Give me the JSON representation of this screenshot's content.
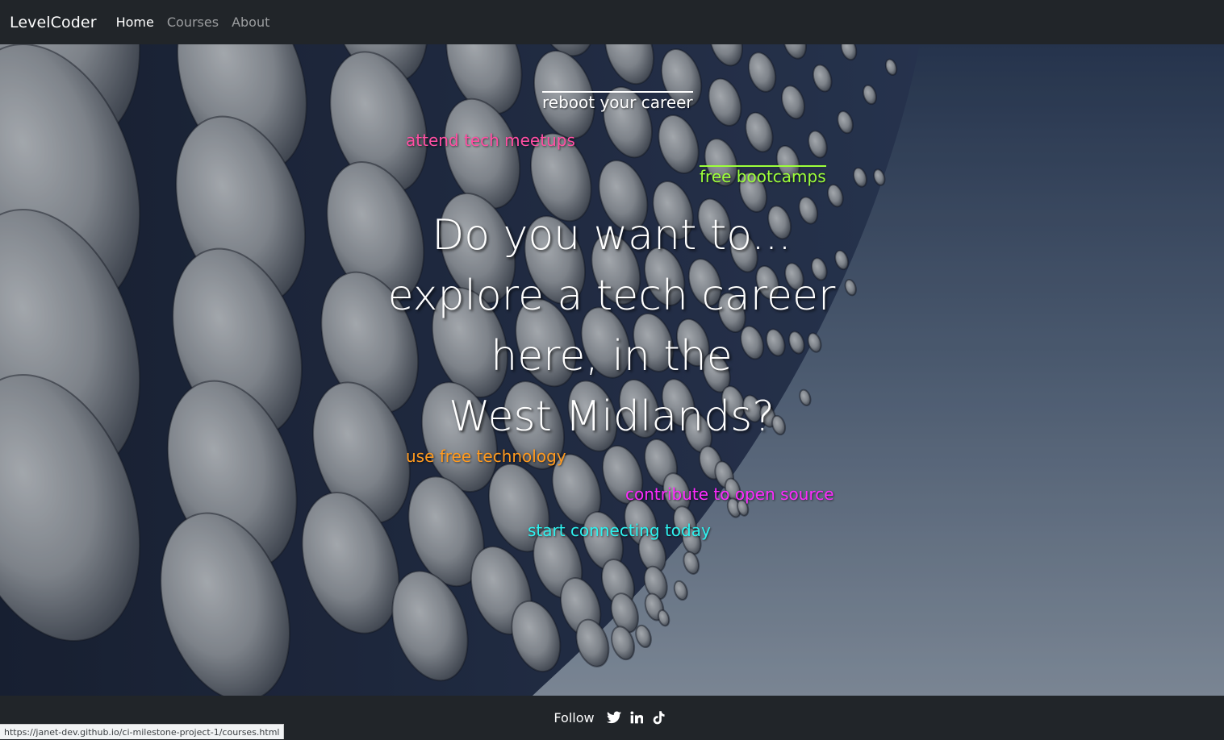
{
  "navbar": {
    "brand": "LevelCoder",
    "links": [
      {
        "label": "Home",
        "active": true
      },
      {
        "label": "Courses",
        "active": false
      },
      {
        "label": "About",
        "active": false
      }
    ]
  },
  "hero": {
    "taglines": {
      "reboot": "reboot your career",
      "meetups": "attend tech meetups",
      "bootcamps": "free bootcamps",
      "free_tech": "use free technology",
      "open_source": "contribute to open source",
      "connecting": "start connecting today"
    },
    "headline": {
      "line1": "Do you want to...",
      "line2": "explore a tech career",
      "line3": "here, in the",
      "line4": "West Midlands?"
    },
    "colors": {
      "reboot": "#ffffff",
      "meetups": "#ff4fa3",
      "bootcamps": "#9dff3a",
      "free_tech": "#ff9a1f",
      "open_source": "#ff2bff",
      "connecting": "#2ef2ef"
    }
  },
  "footer": {
    "follow_label": "Follow",
    "icons": [
      "twitter-icon",
      "linkedin-icon",
      "tiktok-icon"
    ]
  },
  "status_bar": {
    "url": "https://janet-dev.github.io/ci-milestone-project-1/courses.html"
  }
}
